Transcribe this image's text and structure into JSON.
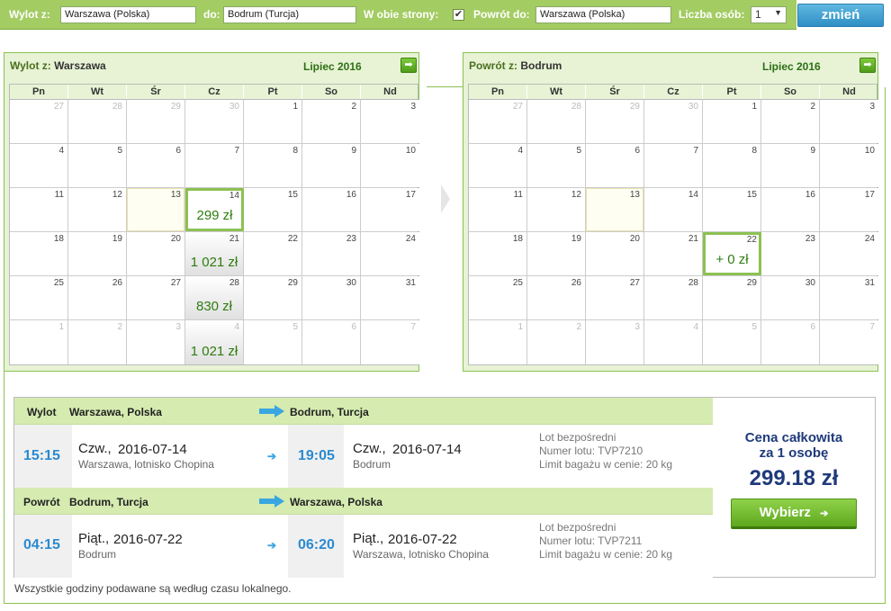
{
  "search": {
    "from_label": "Wylot z:",
    "from_value": "Warszawa (Polska)",
    "to_label": "do:",
    "to_value": "Bodrum (Turcja)",
    "roundtrip_label": "W obie strony:",
    "roundtrip_checked": "✔",
    "return_label": "Powrót do:",
    "return_value": "Warszawa (Polska)",
    "persons_label": "Liczba osób:",
    "persons_value": "1",
    "persons_arrow": "▼",
    "change_button": "zmień"
  },
  "colors": {
    "green": "#8cc152",
    "blue": "#2b8ad0",
    "navy": "#1f3a7a"
  },
  "cal_out": {
    "label": "Wylot z:",
    "city": "Warszawa",
    "month": "Lipiec 2016",
    "next_icon": "➡",
    "dow": [
      "Pn",
      "Wt",
      "Śr",
      "Cz",
      "Pt",
      "So",
      "Nd"
    ],
    "weeks": [
      [
        {
          "n": "27",
          "other": true
        },
        {
          "n": "28",
          "other": true
        },
        {
          "n": "29",
          "other": true
        },
        {
          "n": "30",
          "other": true
        },
        {
          "n": "1"
        },
        {
          "n": "2"
        },
        {
          "n": "3"
        }
      ],
      [
        {
          "n": "4"
        },
        {
          "n": "5"
        },
        {
          "n": "6"
        },
        {
          "n": "7"
        },
        {
          "n": "8"
        },
        {
          "n": "9"
        },
        {
          "n": "10"
        }
      ],
      [
        {
          "n": "11"
        },
        {
          "n": "12"
        },
        {
          "n": "13",
          "today": true
        },
        {
          "n": "14",
          "price": "299 zł",
          "selected": true
        },
        {
          "n": "15"
        },
        {
          "n": "16"
        },
        {
          "n": "17"
        }
      ],
      [
        {
          "n": "18"
        },
        {
          "n": "19"
        },
        {
          "n": "20"
        },
        {
          "n": "21",
          "price": "1 021 zł"
        },
        {
          "n": "22"
        },
        {
          "n": "23"
        },
        {
          "n": "24"
        }
      ],
      [
        {
          "n": "25"
        },
        {
          "n": "26"
        },
        {
          "n": "27"
        },
        {
          "n": "28",
          "price": "830 zł"
        },
        {
          "n": "29"
        },
        {
          "n": "30"
        },
        {
          "n": "31"
        }
      ],
      [
        {
          "n": "1",
          "other": true
        },
        {
          "n": "2",
          "other": true
        },
        {
          "n": "3",
          "other": true
        },
        {
          "n": "4",
          "other": true,
          "price": "1 021 zł"
        },
        {
          "n": "5",
          "other": true
        },
        {
          "n": "6",
          "other": true
        },
        {
          "n": "7",
          "other": true
        }
      ]
    ]
  },
  "cal_ret": {
    "label": "Powrót z:",
    "city": "Bodrum",
    "month": "Lipiec 2016",
    "next_icon": "➡",
    "dow": [
      "Pn",
      "Wt",
      "Śr",
      "Cz",
      "Pt",
      "So",
      "Nd"
    ],
    "weeks": [
      [
        {
          "n": "27",
          "other": true
        },
        {
          "n": "28",
          "other": true
        },
        {
          "n": "29",
          "other": true
        },
        {
          "n": "30",
          "other": true
        },
        {
          "n": "1"
        },
        {
          "n": "2"
        },
        {
          "n": "3"
        }
      ],
      [
        {
          "n": "4"
        },
        {
          "n": "5"
        },
        {
          "n": "6"
        },
        {
          "n": "7"
        },
        {
          "n": "8"
        },
        {
          "n": "9"
        },
        {
          "n": "10"
        }
      ],
      [
        {
          "n": "11"
        },
        {
          "n": "12"
        },
        {
          "n": "13",
          "today": true
        },
        {
          "n": "14"
        },
        {
          "n": "15"
        },
        {
          "n": "16"
        },
        {
          "n": "17"
        }
      ],
      [
        {
          "n": "18"
        },
        {
          "n": "19"
        },
        {
          "n": "20"
        },
        {
          "n": "21"
        },
        {
          "n": "22",
          "price": "+ 0 zł",
          "selected": true
        },
        {
          "n": "23"
        },
        {
          "n": "24"
        }
      ],
      [
        {
          "n": "25"
        },
        {
          "n": "26"
        },
        {
          "n": "27"
        },
        {
          "n": "28"
        },
        {
          "n": "29"
        },
        {
          "n": "30"
        },
        {
          "n": "31"
        }
      ],
      [
        {
          "n": "1",
          "other": true
        },
        {
          "n": "2",
          "other": true
        },
        {
          "n": "3",
          "other": true
        },
        {
          "n": "4",
          "other": true
        },
        {
          "n": "5",
          "other": true
        },
        {
          "n": "6",
          "other": true
        },
        {
          "n": "7",
          "other": true
        }
      ]
    ]
  },
  "flight_out": {
    "type": "Wylot",
    "from": "Warszawa, Polska",
    "to": "Bodrum, Turcja",
    "dep_time": "15:15",
    "dep_day": "Czw.,",
    "dep_date": "2016-07-14",
    "dep_place": "Warszawa, lotnisko Chopina",
    "arr_time": "19:05",
    "arr_day": "Czw.,",
    "arr_date": "2016-07-14",
    "arr_place": "Bodrum",
    "info_direct": "Lot bezpośredni",
    "info_number": "Numer lotu: TVP7210",
    "info_baggage": "Limit bagażu w cenie: 20 kg",
    "arrow_icon": "➔"
  },
  "flight_ret": {
    "type": "Powrót",
    "from": "Bodrum, Turcja",
    "to": "Warszawa, Polska",
    "dep_time": "04:15",
    "dep_day": "Piąt.,",
    "dep_date": "2016-07-22",
    "dep_place": "Bodrum",
    "arr_time": "06:20",
    "arr_day": "Piąt.,",
    "arr_date": "2016-07-22",
    "arr_place": "Warszawa, lotnisko Chopina",
    "info_direct": "Lot bezpośredni",
    "info_number": "Numer lotu: TVP7211",
    "info_baggage": "Limit bagażu w cenie: 20 kg",
    "arrow_icon": "➔"
  },
  "price": {
    "label_line1": "Cena całkowita",
    "label_line2": "za 1 osobę",
    "total": "299.18 zł",
    "button": "Wybierz",
    "button_icon": "➔"
  },
  "footnote": "Wszystkie godziny podawane są według czasu lokalnego."
}
